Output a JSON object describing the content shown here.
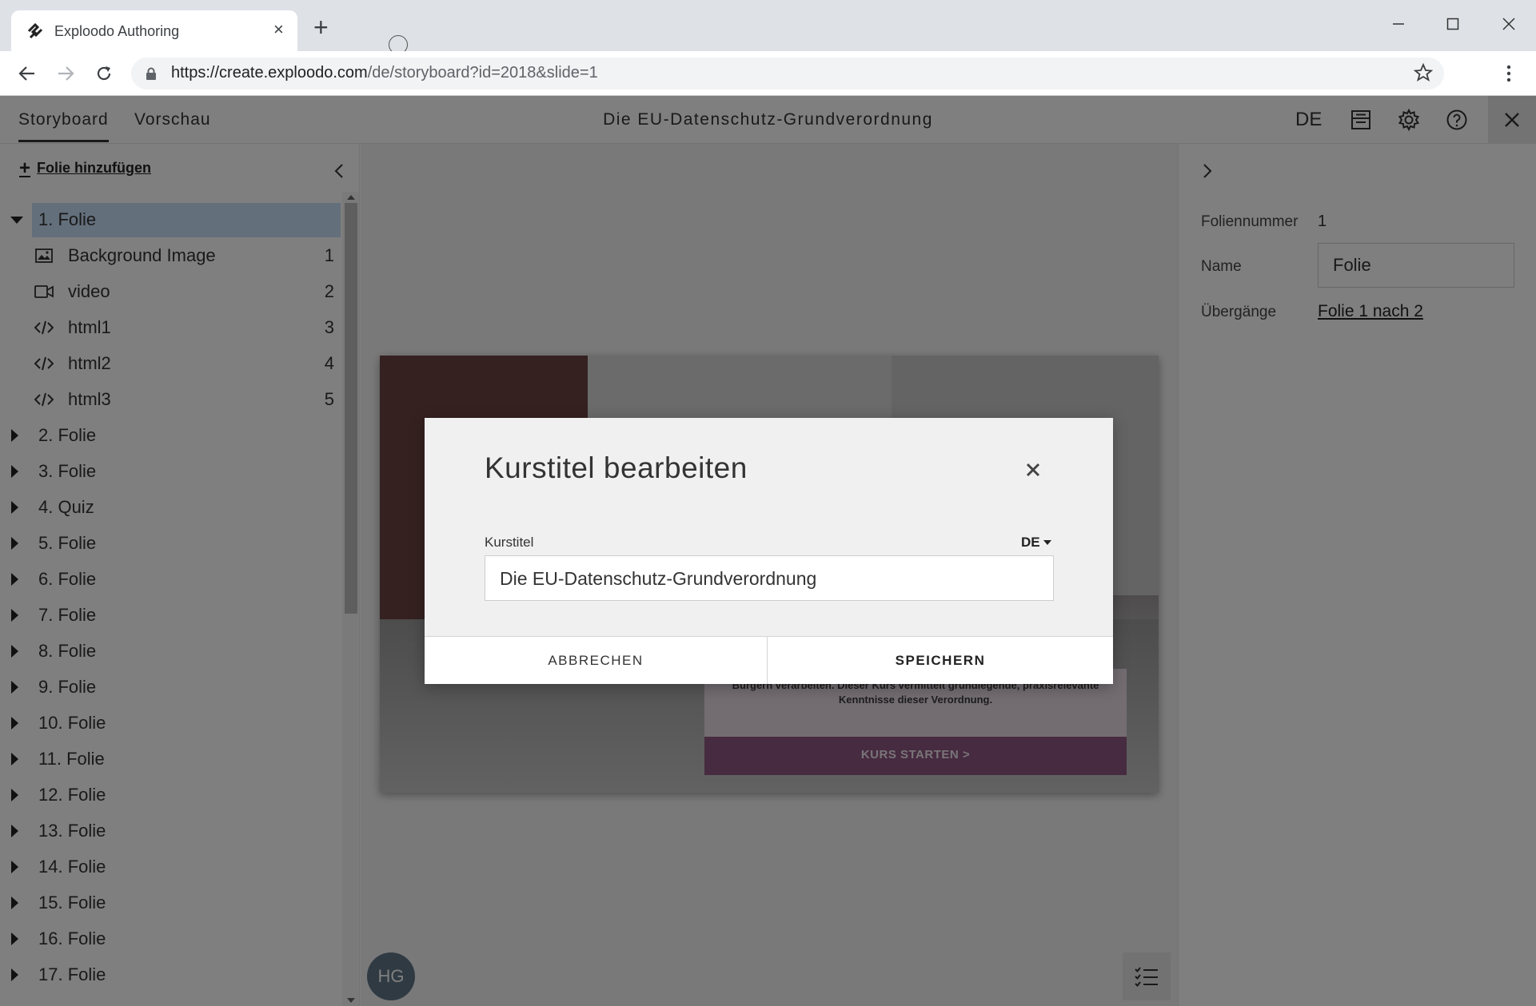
{
  "browser": {
    "tab_title": "Exploodo Authoring",
    "url_host": "https://create.exploodo.com",
    "url_path": "/de/storyboard?id=2018&slide=1"
  },
  "header": {
    "tabs": [
      {
        "label": "Storyboard",
        "active": true
      },
      {
        "label": "Vorschau",
        "active": false
      }
    ],
    "title": "Die EU-Datenschutz-Grundverordnung",
    "language": "DE"
  },
  "sidebar": {
    "add_slide_label": "Folie hinzufügen",
    "slides": [
      {
        "label": "1. Folie",
        "expanded": true,
        "selected": true,
        "children": [
          {
            "label": "Background Image",
            "number": "1",
            "icon": "image-icon"
          },
          {
            "label": "video",
            "number": "2",
            "icon": "video-icon"
          },
          {
            "label": "html1",
            "number": "3",
            "icon": "code-icon"
          },
          {
            "label": "html2",
            "number": "4",
            "icon": "code-icon"
          },
          {
            "label": "html3",
            "number": "5",
            "icon": "code-icon"
          }
        ]
      },
      {
        "label": "2. Folie"
      },
      {
        "label": "3. Folie"
      },
      {
        "label": "4. Quiz"
      },
      {
        "label": "5. Folie"
      },
      {
        "label": "6. Folie"
      },
      {
        "label": "7. Folie"
      },
      {
        "label": "8. Folie"
      },
      {
        "label": "9. Folie"
      },
      {
        "label": "10. Folie"
      },
      {
        "label": "11. Folie"
      },
      {
        "label": "12. Folie"
      },
      {
        "label": "13. Folie"
      },
      {
        "label": "14. Folie"
      },
      {
        "label": "15. Folie"
      },
      {
        "label": "16. Folie"
      },
      {
        "label": "17. Folie"
      }
    ]
  },
  "slide_preview": {
    "panel_text_line1": "Bürgern verarbeiten. Dieser Kurs vermittelt grundlegende, praxisrelevante",
    "panel_text_line2": "Kenntnisse dieser Verordnung.",
    "cta_label": "KURS STARTEN >",
    "cta_color": "#8e5780"
  },
  "user": {
    "initials": "HG",
    "avatar_color": "#607487"
  },
  "properties": {
    "slide_number_label": "Foliennummer",
    "slide_number": "1",
    "name_label": "Name",
    "name_value": "Folie",
    "transitions_label": "Übergänge",
    "transition_link": "Folie 1 nach 2"
  },
  "modal": {
    "title": "Kurstitel bearbeiten",
    "field_label": "Kurstitel",
    "language": "DE",
    "field_value": "Die EU-Datenschutz-Grundverordnung",
    "cancel_label": "ABBRECHEN",
    "save_label": "SPEICHERN"
  }
}
